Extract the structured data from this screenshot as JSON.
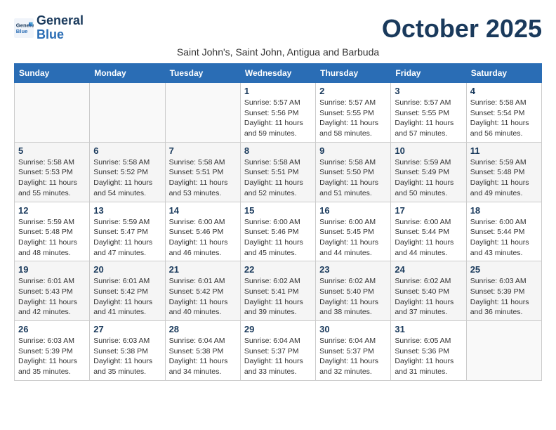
{
  "header": {
    "logo_line1": "General",
    "logo_line2": "Blue",
    "month_title": "October 2025",
    "subtitle": "Saint John's, Saint John, Antigua and Barbuda"
  },
  "weekdays": [
    "Sunday",
    "Monday",
    "Tuesday",
    "Wednesday",
    "Thursday",
    "Friday",
    "Saturday"
  ],
  "weeks": [
    [
      {
        "day": "",
        "info": ""
      },
      {
        "day": "",
        "info": ""
      },
      {
        "day": "",
        "info": ""
      },
      {
        "day": "1",
        "info": "Sunrise: 5:57 AM\nSunset: 5:56 PM\nDaylight: 11 hours\nand 59 minutes."
      },
      {
        "day": "2",
        "info": "Sunrise: 5:57 AM\nSunset: 5:55 PM\nDaylight: 11 hours\nand 58 minutes."
      },
      {
        "day": "3",
        "info": "Sunrise: 5:57 AM\nSunset: 5:55 PM\nDaylight: 11 hours\nand 57 minutes."
      },
      {
        "day": "4",
        "info": "Sunrise: 5:58 AM\nSunset: 5:54 PM\nDaylight: 11 hours\nand 56 minutes."
      }
    ],
    [
      {
        "day": "5",
        "info": "Sunrise: 5:58 AM\nSunset: 5:53 PM\nDaylight: 11 hours\nand 55 minutes."
      },
      {
        "day": "6",
        "info": "Sunrise: 5:58 AM\nSunset: 5:52 PM\nDaylight: 11 hours\nand 54 minutes."
      },
      {
        "day": "7",
        "info": "Sunrise: 5:58 AM\nSunset: 5:51 PM\nDaylight: 11 hours\nand 53 minutes."
      },
      {
        "day": "8",
        "info": "Sunrise: 5:58 AM\nSunset: 5:51 PM\nDaylight: 11 hours\nand 52 minutes."
      },
      {
        "day": "9",
        "info": "Sunrise: 5:58 AM\nSunset: 5:50 PM\nDaylight: 11 hours\nand 51 minutes."
      },
      {
        "day": "10",
        "info": "Sunrise: 5:59 AM\nSunset: 5:49 PM\nDaylight: 11 hours\nand 50 minutes."
      },
      {
        "day": "11",
        "info": "Sunrise: 5:59 AM\nSunset: 5:48 PM\nDaylight: 11 hours\nand 49 minutes."
      }
    ],
    [
      {
        "day": "12",
        "info": "Sunrise: 5:59 AM\nSunset: 5:48 PM\nDaylight: 11 hours\nand 48 minutes."
      },
      {
        "day": "13",
        "info": "Sunrise: 5:59 AM\nSunset: 5:47 PM\nDaylight: 11 hours\nand 47 minutes."
      },
      {
        "day": "14",
        "info": "Sunrise: 6:00 AM\nSunset: 5:46 PM\nDaylight: 11 hours\nand 46 minutes."
      },
      {
        "day": "15",
        "info": "Sunrise: 6:00 AM\nSunset: 5:46 PM\nDaylight: 11 hours\nand 45 minutes."
      },
      {
        "day": "16",
        "info": "Sunrise: 6:00 AM\nSunset: 5:45 PM\nDaylight: 11 hours\nand 44 minutes."
      },
      {
        "day": "17",
        "info": "Sunrise: 6:00 AM\nSunset: 5:44 PM\nDaylight: 11 hours\nand 44 minutes."
      },
      {
        "day": "18",
        "info": "Sunrise: 6:00 AM\nSunset: 5:44 PM\nDaylight: 11 hours\nand 43 minutes."
      }
    ],
    [
      {
        "day": "19",
        "info": "Sunrise: 6:01 AM\nSunset: 5:43 PM\nDaylight: 11 hours\nand 42 minutes."
      },
      {
        "day": "20",
        "info": "Sunrise: 6:01 AM\nSunset: 5:42 PM\nDaylight: 11 hours\nand 41 minutes."
      },
      {
        "day": "21",
        "info": "Sunrise: 6:01 AM\nSunset: 5:42 PM\nDaylight: 11 hours\nand 40 minutes."
      },
      {
        "day": "22",
        "info": "Sunrise: 6:02 AM\nSunset: 5:41 PM\nDaylight: 11 hours\nand 39 minutes."
      },
      {
        "day": "23",
        "info": "Sunrise: 6:02 AM\nSunset: 5:40 PM\nDaylight: 11 hours\nand 38 minutes."
      },
      {
        "day": "24",
        "info": "Sunrise: 6:02 AM\nSunset: 5:40 PM\nDaylight: 11 hours\nand 37 minutes."
      },
      {
        "day": "25",
        "info": "Sunrise: 6:03 AM\nSunset: 5:39 PM\nDaylight: 11 hours\nand 36 minutes."
      }
    ],
    [
      {
        "day": "26",
        "info": "Sunrise: 6:03 AM\nSunset: 5:39 PM\nDaylight: 11 hours\nand 35 minutes."
      },
      {
        "day": "27",
        "info": "Sunrise: 6:03 AM\nSunset: 5:38 PM\nDaylight: 11 hours\nand 35 minutes."
      },
      {
        "day": "28",
        "info": "Sunrise: 6:04 AM\nSunset: 5:38 PM\nDaylight: 11 hours\nand 34 minutes."
      },
      {
        "day": "29",
        "info": "Sunrise: 6:04 AM\nSunset: 5:37 PM\nDaylight: 11 hours\nand 33 minutes."
      },
      {
        "day": "30",
        "info": "Sunrise: 6:04 AM\nSunset: 5:37 PM\nDaylight: 11 hours\nand 32 minutes."
      },
      {
        "day": "31",
        "info": "Sunrise: 6:05 AM\nSunset: 5:36 PM\nDaylight: 11 hours\nand 31 minutes."
      },
      {
        "day": "",
        "info": ""
      }
    ]
  ]
}
